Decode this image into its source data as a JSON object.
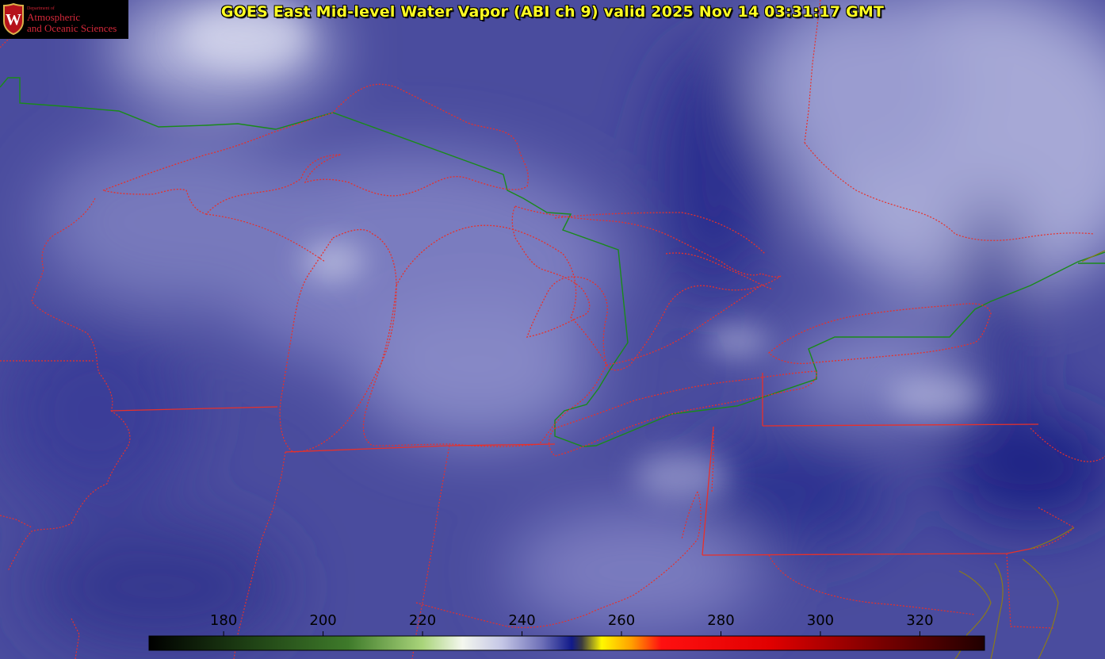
{
  "title": "GOES East Mid-level Water Vapor (ABI ch 9)  valid 2025 Nov 14 03:31:17 GMT",
  "logo": {
    "dept": "Department of",
    "line1": "Atmospheric",
    "line2": "and Oceanic Sciences",
    "seal_letter": "W"
  },
  "colorbar": {
    "ticks": [
      "180",
      "200",
      "220",
      "240",
      "260",
      "280",
      "300",
      "320"
    ],
    "tick_values": [
      180,
      200,
      220,
      240,
      260,
      280,
      300,
      320
    ],
    "range": [
      165,
      333
    ],
    "stops": [
      {
        "v": 165,
        "c": "#000000"
      },
      {
        "v": 185,
        "c": "#1e4014"
      },
      {
        "v": 205,
        "c": "#3e7a2a"
      },
      {
        "v": 220,
        "c": "#a9d47a"
      },
      {
        "v": 228,
        "c": "#f4f7ee"
      },
      {
        "v": 236,
        "c": "#c4c6e6"
      },
      {
        "v": 244,
        "c": "#6e70b8"
      },
      {
        "v": 250,
        "c": "#111a8a"
      },
      {
        "v": 252,
        "c": "#3a3a40"
      },
      {
        "v": 256,
        "c": "#fff800"
      },
      {
        "v": 262,
        "c": "#ffa000"
      },
      {
        "v": 268,
        "c": "#ff1010"
      },
      {
        "v": 290,
        "c": "#e00000"
      },
      {
        "v": 312,
        "c": "#7a0000"
      },
      {
        "v": 333,
        "c": "#200000"
      }
    ]
  },
  "colors": {
    "state_borders": "#e8302a",
    "country_border": "#1a8a1a",
    "shoreline": "#e8302a"
  }
}
